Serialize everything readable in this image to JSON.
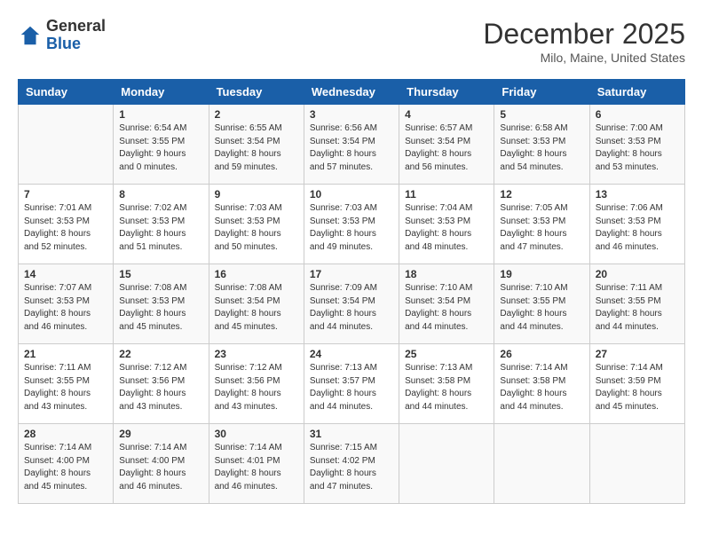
{
  "header": {
    "logo_line1": "General",
    "logo_line2": "Blue",
    "title": "December 2025",
    "subtitle": "Milo, Maine, United States"
  },
  "days_of_week": [
    "Sunday",
    "Monday",
    "Tuesday",
    "Wednesday",
    "Thursday",
    "Friday",
    "Saturday"
  ],
  "weeks": [
    [
      {
        "day": "",
        "sunrise": "",
        "sunset": "",
        "daylight": ""
      },
      {
        "day": "1",
        "sunrise": "Sunrise: 6:54 AM",
        "sunset": "Sunset: 3:55 PM",
        "daylight": "Daylight: 9 hours and 0 minutes."
      },
      {
        "day": "2",
        "sunrise": "Sunrise: 6:55 AM",
        "sunset": "Sunset: 3:54 PM",
        "daylight": "Daylight: 8 hours and 59 minutes."
      },
      {
        "day": "3",
        "sunrise": "Sunrise: 6:56 AM",
        "sunset": "Sunset: 3:54 PM",
        "daylight": "Daylight: 8 hours and 57 minutes."
      },
      {
        "day": "4",
        "sunrise": "Sunrise: 6:57 AM",
        "sunset": "Sunset: 3:54 PM",
        "daylight": "Daylight: 8 hours and 56 minutes."
      },
      {
        "day": "5",
        "sunrise": "Sunrise: 6:58 AM",
        "sunset": "Sunset: 3:53 PM",
        "daylight": "Daylight: 8 hours and 54 minutes."
      },
      {
        "day": "6",
        "sunrise": "Sunrise: 7:00 AM",
        "sunset": "Sunset: 3:53 PM",
        "daylight": "Daylight: 8 hours and 53 minutes."
      }
    ],
    [
      {
        "day": "7",
        "sunrise": "Sunrise: 7:01 AM",
        "sunset": "Sunset: 3:53 PM",
        "daylight": "Daylight: 8 hours and 52 minutes."
      },
      {
        "day": "8",
        "sunrise": "Sunrise: 7:02 AM",
        "sunset": "Sunset: 3:53 PM",
        "daylight": "Daylight: 8 hours and 51 minutes."
      },
      {
        "day": "9",
        "sunrise": "Sunrise: 7:03 AM",
        "sunset": "Sunset: 3:53 PM",
        "daylight": "Daylight: 8 hours and 50 minutes."
      },
      {
        "day": "10",
        "sunrise": "Sunrise: 7:03 AM",
        "sunset": "Sunset: 3:53 PM",
        "daylight": "Daylight: 8 hours and 49 minutes."
      },
      {
        "day": "11",
        "sunrise": "Sunrise: 7:04 AM",
        "sunset": "Sunset: 3:53 PM",
        "daylight": "Daylight: 8 hours and 48 minutes."
      },
      {
        "day": "12",
        "sunrise": "Sunrise: 7:05 AM",
        "sunset": "Sunset: 3:53 PM",
        "daylight": "Daylight: 8 hours and 47 minutes."
      },
      {
        "day": "13",
        "sunrise": "Sunrise: 7:06 AM",
        "sunset": "Sunset: 3:53 PM",
        "daylight": "Daylight: 8 hours and 46 minutes."
      }
    ],
    [
      {
        "day": "14",
        "sunrise": "Sunrise: 7:07 AM",
        "sunset": "Sunset: 3:53 PM",
        "daylight": "Daylight: 8 hours and 46 minutes."
      },
      {
        "day": "15",
        "sunrise": "Sunrise: 7:08 AM",
        "sunset": "Sunset: 3:53 PM",
        "daylight": "Daylight: 8 hours and 45 minutes."
      },
      {
        "day": "16",
        "sunrise": "Sunrise: 7:08 AM",
        "sunset": "Sunset: 3:54 PM",
        "daylight": "Daylight: 8 hours and 45 minutes."
      },
      {
        "day": "17",
        "sunrise": "Sunrise: 7:09 AM",
        "sunset": "Sunset: 3:54 PM",
        "daylight": "Daylight: 8 hours and 44 minutes."
      },
      {
        "day": "18",
        "sunrise": "Sunrise: 7:10 AM",
        "sunset": "Sunset: 3:54 PM",
        "daylight": "Daylight: 8 hours and 44 minutes."
      },
      {
        "day": "19",
        "sunrise": "Sunrise: 7:10 AM",
        "sunset": "Sunset: 3:55 PM",
        "daylight": "Daylight: 8 hours and 44 minutes."
      },
      {
        "day": "20",
        "sunrise": "Sunrise: 7:11 AM",
        "sunset": "Sunset: 3:55 PM",
        "daylight": "Daylight: 8 hours and 44 minutes."
      }
    ],
    [
      {
        "day": "21",
        "sunrise": "Sunrise: 7:11 AM",
        "sunset": "Sunset: 3:55 PM",
        "daylight": "Daylight: 8 hours and 43 minutes."
      },
      {
        "day": "22",
        "sunrise": "Sunrise: 7:12 AM",
        "sunset": "Sunset: 3:56 PM",
        "daylight": "Daylight: 8 hours and 43 minutes."
      },
      {
        "day": "23",
        "sunrise": "Sunrise: 7:12 AM",
        "sunset": "Sunset: 3:56 PM",
        "daylight": "Daylight: 8 hours and 43 minutes."
      },
      {
        "day": "24",
        "sunrise": "Sunrise: 7:13 AM",
        "sunset": "Sunset: 3:57 PM",
        "daylight": "Daylight: 8 hours and 44 minutes."
      },
      {
        "day": "25",
        "sunrise": "Sunrise: 7:13 AM",
        "sunset": "Sunset: 3:58 PM",
        "daylight": "Daylight: 8 hours and 44 minutes."
      },
      {
        "day": "26",
        "sunrise": "Sunrise: 7:14 AM",
        "sunset": "Sunset: 3:58 PM",
        "daylight": "Daylight: 8 hours and 44 minutes."
      },
      {
        "day": "27",
        "sunrise": "Sunrise: 7:14 AM",
        "sunset": "Sunset: 3:59 PM",
        "daylight": "Daylight: 8 hours and 45 minutes."
      }
    ],
    [
      {
        "day": "28",
        "sunrise": "Sunrise: 7:14 AM",
        "sunset": "Sunset: 4:00 PM",
        "daylight": "Daylight: 8 hours and 45 minutes."
      },
      {
        "day": "29",
        "sunrise": "Sunrise: 7:14 AM",
        "sunset": "Sunset: 4:00 PM",
        "daylight": "Daylight: 8 hours and 46 minutes."
      },
      {
        "day": "30",
        "sunrise": "Sunrise: 7:14 AM",
        "sunset": "Sunset: 4:01 PM",
        "daylight": "Daylight: 8 hours and 46 minutes."
      },
      {
        "day": "31",
        "sunrise": "Sunrise: 7:15 AM",
        "sunset": "Sunset: 4:02 PM",
        "daylight": "Daylight: 8 hours and 47 minutes."
      },
      {
        "day": "",
        "sunrise": "",
        "sunset": "",
        "daylight": ""
      },
      {
        "day": "",
        "sunrise": "",
        "sunset": "",
        "daylight": ""
      },
      {
        "day": "",
        "sunrise": "",
        "sunset": "",
        "daylight": ""
      }
    ]
  ]
}
